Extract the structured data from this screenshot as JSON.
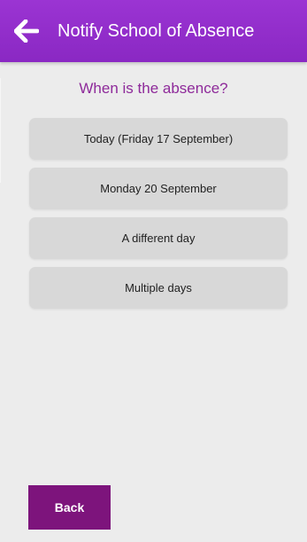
{
  "header": {
    "title": "Notify School of Absence",
    "back_icon": "left-arrow-icon"
  },
  "question": "When is the absence?",
  "options": [
    {
      "label": "Today (Friday 17 September)"
    },
    {
      "label": "Monday 20 September"
    },
    {
      "label": "A different day"
    },
    {
      "label": "Multiple days"
    }
  ],
  "footer": {
    "back_label": "Back"
  },
  "colors": {
    "header_purple": "#9b34d3",
    "question_text": "#8e2a9a",
    "option_bg": "#d8d8d8",
    "back_button_bg": "#7d147c",
    "page_bg": "#ececec"
  }
}
